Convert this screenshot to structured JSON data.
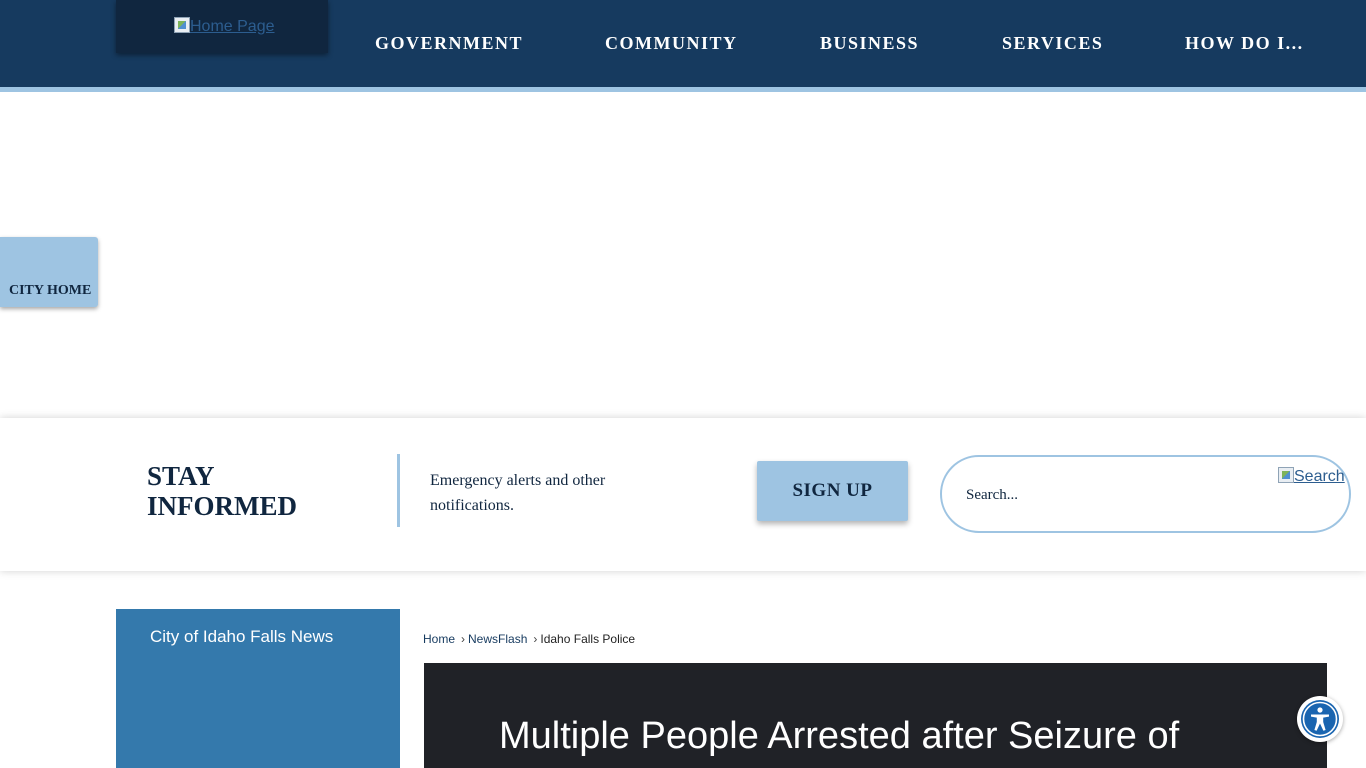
{
  "header": {
    "logo_alt": "Home Page",
    "nav": [
      {
        "label": "GOVERNMENT"
      },
      {
        "label": "COMMUNITY"
      },
      {
        "label": "BUSINESS"
      },
      {
        "label": "SERVICES"
      },
      {
        "label": "HOW DO I..."
      }
    ]
  },
  "city_home": {
    "label": "CITY HOME"
  },
  "stay_informed": {
    "title": "STAY INFORMED",
    "description": "Emergency alerts and other notifications.",
    "signup_label": "SIGN UP"
  },
  "search": {
    "placeholder": "Search...",
    "button_alt": "Search"
  },
  "side_nav": {
    "title": "City of Idaho Falls News"
  },
  "breadcrumb": {
    "home": "Home",
    "newsflash": "NewsFlash",
    "current": "Idaho Falls Police"
  },
  "article": {
    "title": "Multiple People Arrested after Seizure of"
  },
  "colors": {
    "header_bg": "#163a5f",
    "accent_light": "#9ec4e2",
    "side_nav_bg": "#3479ac",
    "article_bg": "#202227"
  }
}
